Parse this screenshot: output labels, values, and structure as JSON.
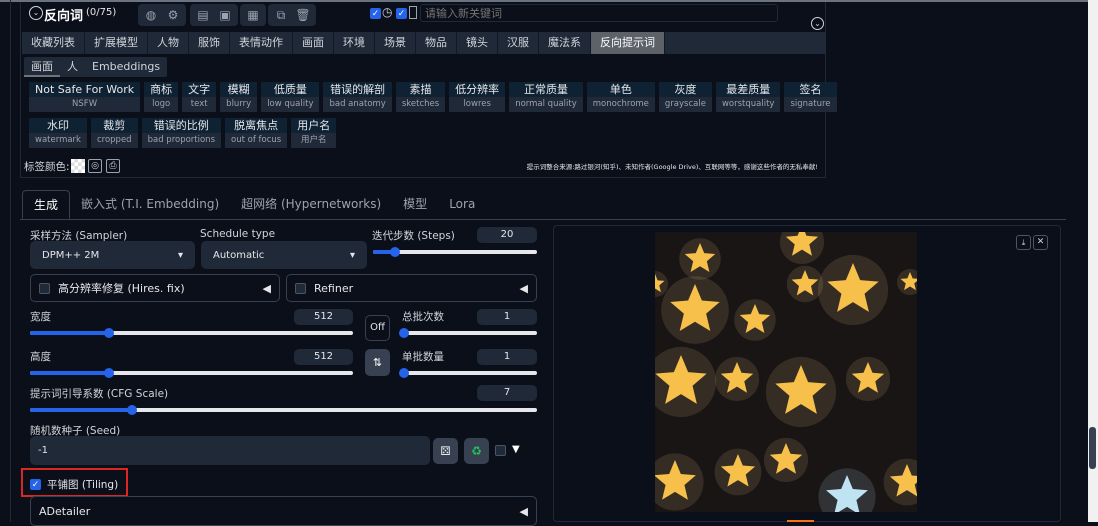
{
  "prompt_header": {
    "title": "反向词",
    "count": "(0/75)",
    "keyword_placeholder": "请输入新关键词"
  },
  "category_tabs": [
    "收藏列表",
    "扩展模型",
    "人物",
    "服饰",
    "表情动作",
    "画面",
    "环境",
    "场景",
    "物品",
    "镜头",
    "汉服",
    "魔法系",
    "反向提示词"
  ],
  "active_category": "反向提示词",
  "sub_tabs": [
    "画面",
    "人",
    "Embeddings"
  ],
  "tags_row1": [
    {
      "label": "Not Safe For Work",
      "value": "NSFW"
    },
    {
      "label": "商标",
      "value": "logo"
    },
    {
      "label": "文字",
      "value": "text"
    },
    {
      "label": "模糊",
      "value": "blurry"
    },
    {
      "label": "低质量",
      "value": "low quality"
    },
    {
      "label": "错误的解剖",
      "value": "bad anatomy"
    },
    {
      "label": "素描",
      "value": "sketches"
    },
    {
      "label": "低分辨率",
      "value": "lowres"
    },
    {
      "label": "正常质量",
      "value": "normal quality"
    },
    {
      "label": "单色",
      "value": "monochrome"
    },
    {
      "label": "灰度",
      "value": "grayscale"
    },
    {
      "label": "最差质量",
      "value": "worstquality"
    },
    {
      "label": "签名",
      "value": "signature"
    }
  ],
  "tags_row2": [
    {
      "label": "水印",
      "value": "watermark"
    },
    {
      "label": "裁剪",
      "value": "cropped"
    },
    {
      "label": "错误的比例",
      "value": "bad proportions"
    },
    {
      "label": "脱离焦点",
      "value": "out of focus"
    },
    {
      "label": "用户名",
      "value": "用户名"
    }
  ],
  "tag_color_label": "标签颜色:",
  "credits": "提示词整合来源:路过银河(知乎)、未知作者(Google Drive)、互联网等等，感谢这些作者的无私奉献!",
  "main_tabs": [
    "生成",
    "嵌入式 (T.I. Embedding)",
    "超网络 (Hypernetworks)",
    "模型",
    "Lora"
  ],
  "gen": {
    "sampler_label": "采样方法 (Sampler)",
    "sampler": "DPM++ 2M",
    "schedule_label": "Schedule type",
    "schedule": "Automatic",
    "steps_label": "迭代步数 (Steps)",
    "steps": "20",
    "hires_label": "高分辨率修复 (Hires. fix)",
    "refiner_label": "Refiner",
    "width_label": "宽度",
    "width": "512",
    "height_label": "高度",
    "height": "512",
    "off_label": "Off",
    "batch_count_label": "总批次数",
    "batch_count": "1",
    "batch_size_label": "单批数量",
    "batch_size": "1",
    "cfg_label": "提示词引导系数 (CFG Scale)",
    "cfg": "7",
    "seed_label": "随机数种子 (Seed)",
    "seed": "-1",
    "tiling_label": "平铺图 (Tiling)",
    "tiling_checked": true,
    "adetailer_label": "ADetailer"
  },
  "slider_fractions": {
    "steps": 0.13,
    "width": 0.24,
    "height": 0.24,
    "batch_count": 0.0,
    "batch_size": 0.0,
    "cfg": 0.2
  },
  "colors": {
    "accent": "#2563eb",
    "highlight_box": "#dc2626",
    "background": "#0b0f19"
  }
}
